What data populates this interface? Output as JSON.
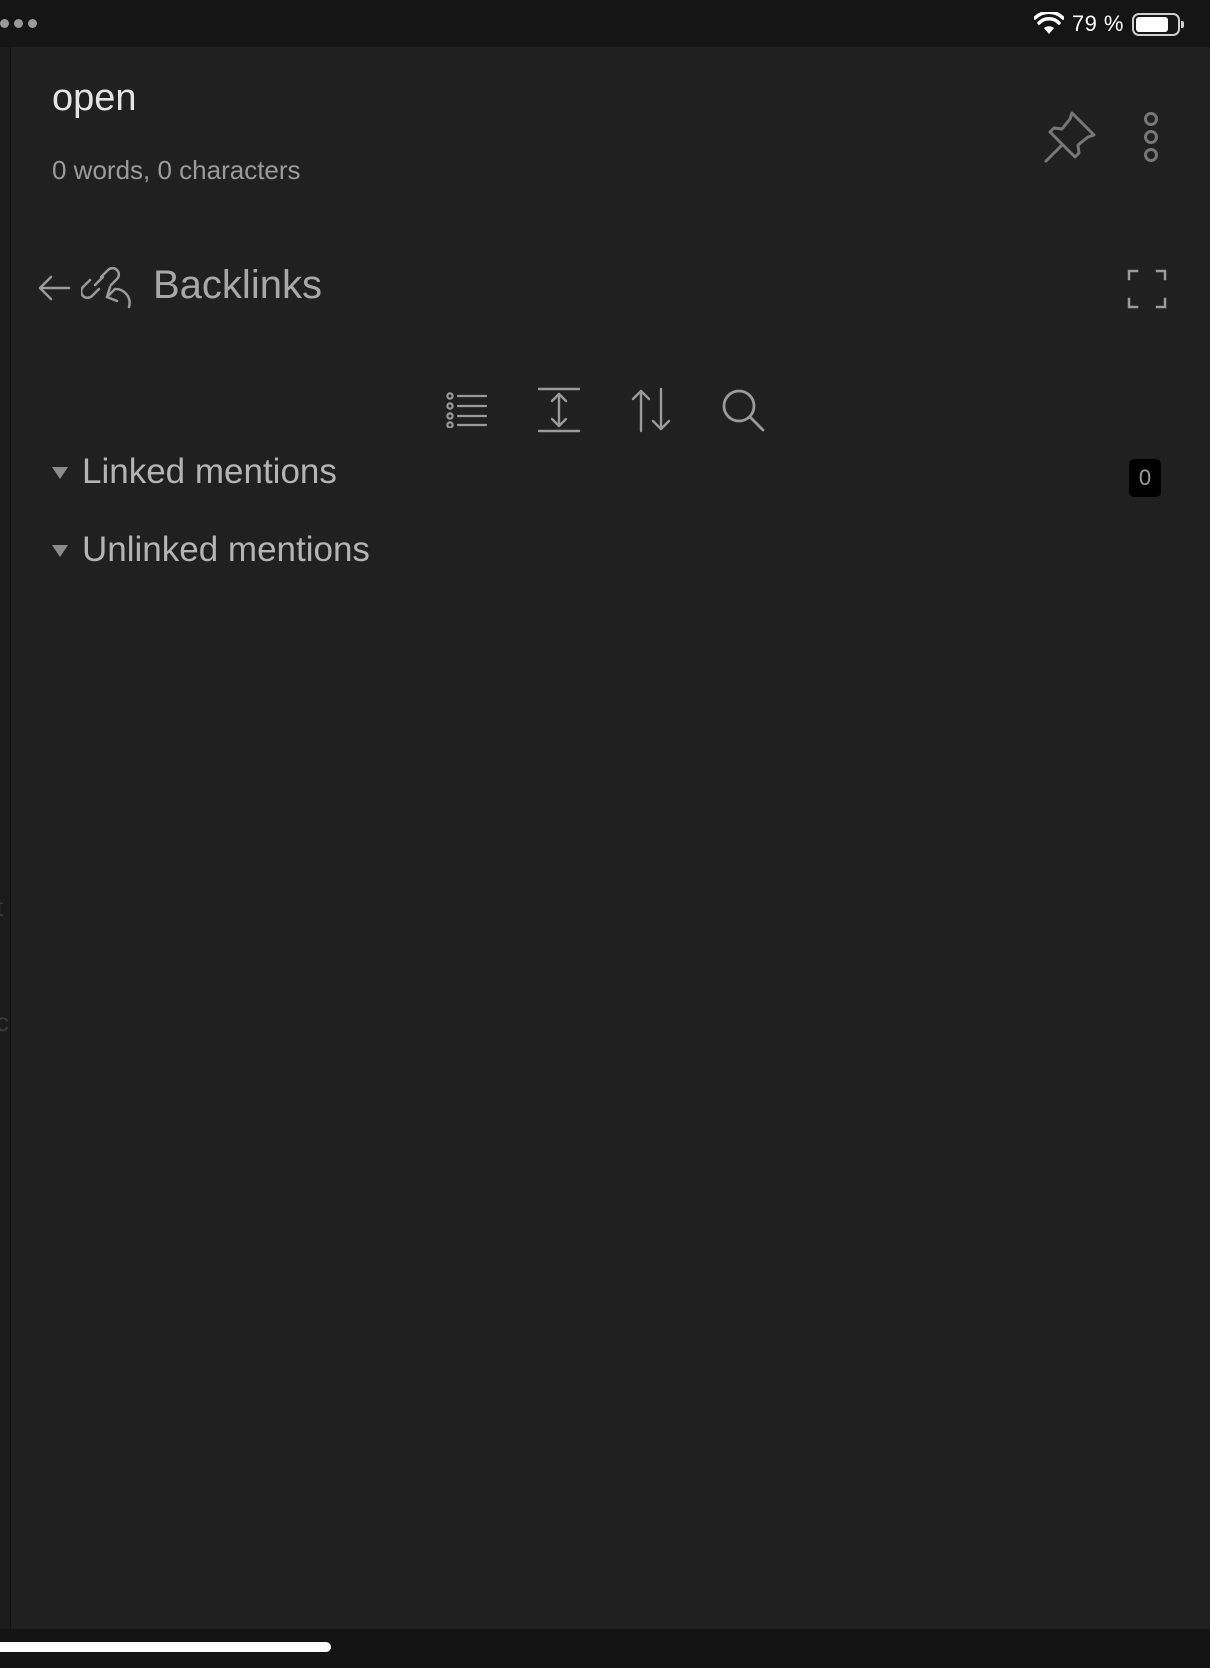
{
  "status_bar": {
    "battery_percent": "79 %",
    "battery_level": 0.79,
    "icons": [
      "multitask-dots-icon",
      "wifi-icon",
      "battery-icon"
    ]
  },
  "note": {
    "title": "open",
    "stats": "0 words, 0 characters"
  },
  "header_actions": {
    "icons": [
      "pin-icon",
      "more-vertical-icon"
    ]
  },
  "backlinks_panel": {
    "title": "Backlinks",
    "icons": [
      "back-arrow-icon",
      "backlinks-icon",
      "expand-icon"
    ],
    "toolbar": [
      "list-icon",
      "expand-height-icon",
      "sort-icon",
      "search-icon"
    ],
    "sections": [
      {
        "label": "Linked mentions",
        "count": "0"
      },
      {
        "label": "Unlinked mentions"
      }
    ]
  },
  "background_fragments": [
    "t",
    "c"
  ],
  "colors": {
    "pane_bg": "#202020",
    "status_bg": "#151515",
    "text_primary": "#e4e4e4",
    "text_muted": "#9b9b9b"
  }
}
